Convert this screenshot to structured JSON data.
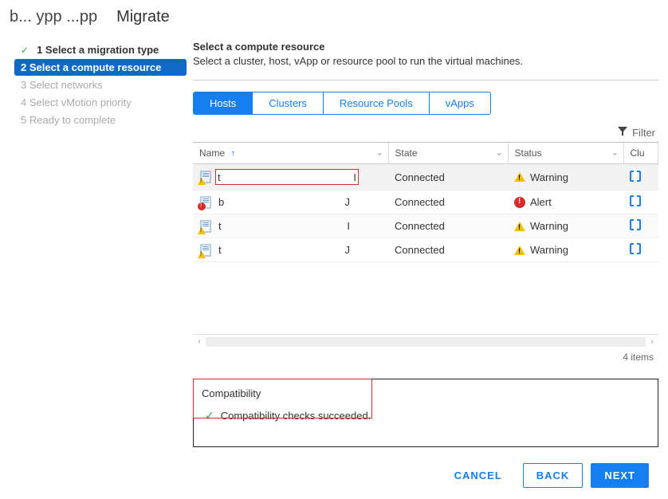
{
  "header": {
    "object_label": "b...  ypp  ...pp",
    "title": "Migrate"
  },
  "wizard": {
    "steps": [
      {
        "num": "1",
        "label": "Select a migration type",
        "state": "completed"
      },
      {
        "num": "2",
        "label": "Select a compute resource",
        "state": "active"
      },
      {
        "num": "3",
        "label": "Select networks",
        "state": "upcoming"
      },
      {
        "num": "4",
        "label": "Select vMotion priority",
        "state": "upcoming"
      },
      {
        "num": "5",
        "label": "Ready to complete",
        "state": "upcoming"
      }
    ]
  },
  "section": {
    "title": "Select a compute resource",
    "desc": "Select a cluster, host, vApp or resource pool to run the virtual machines."
  },
  "tabs": [
    "Hosts",
    "Clusters",
    "Resource Pools",
    "vApps"
  ],
  "active_tab": "Hosts",
  "filter": {
    "label": "Filter"
  },
  "table": {
    "headers": [
      "Name",
      "State",
      "Status",
      "Clu"
    ],
    "sort_col": 0,
    "rows": [
      {
        "name": "t",
        "secondary": "I",
        "state": "Connected",
        "status": "Warning",
        "status_icon": "warning",
        "selected": true,
        "highlight": true
      },
      {
        "name": "b",
        "secondary": "J",
        "state": "Connected",
        "status": "Alert",
        "status_icon": "alert",
        "selected": false
      },
      {
        "name": "t",
        "secondary": "I",
        "state": "Connected",
        "status": "Warning",
        "status_icon": "warning",
        "selected": false
      },
      {
        "name": "t",
        "secondary": "J",
        "state": "Connected",
        "status": "Warning",
        "status_icon": "warning",
        "selected": false
      }
    ],
    "item_count": "4 items"
  },
  "compatibility": {
    "title": "Compatibility",
    "message": "Compatibility checks succeeded."
  },
  "buttons": {
    "cancel": "CANCEL",
    "back": "BACK",
    "next": "NEXT"
  }
}
